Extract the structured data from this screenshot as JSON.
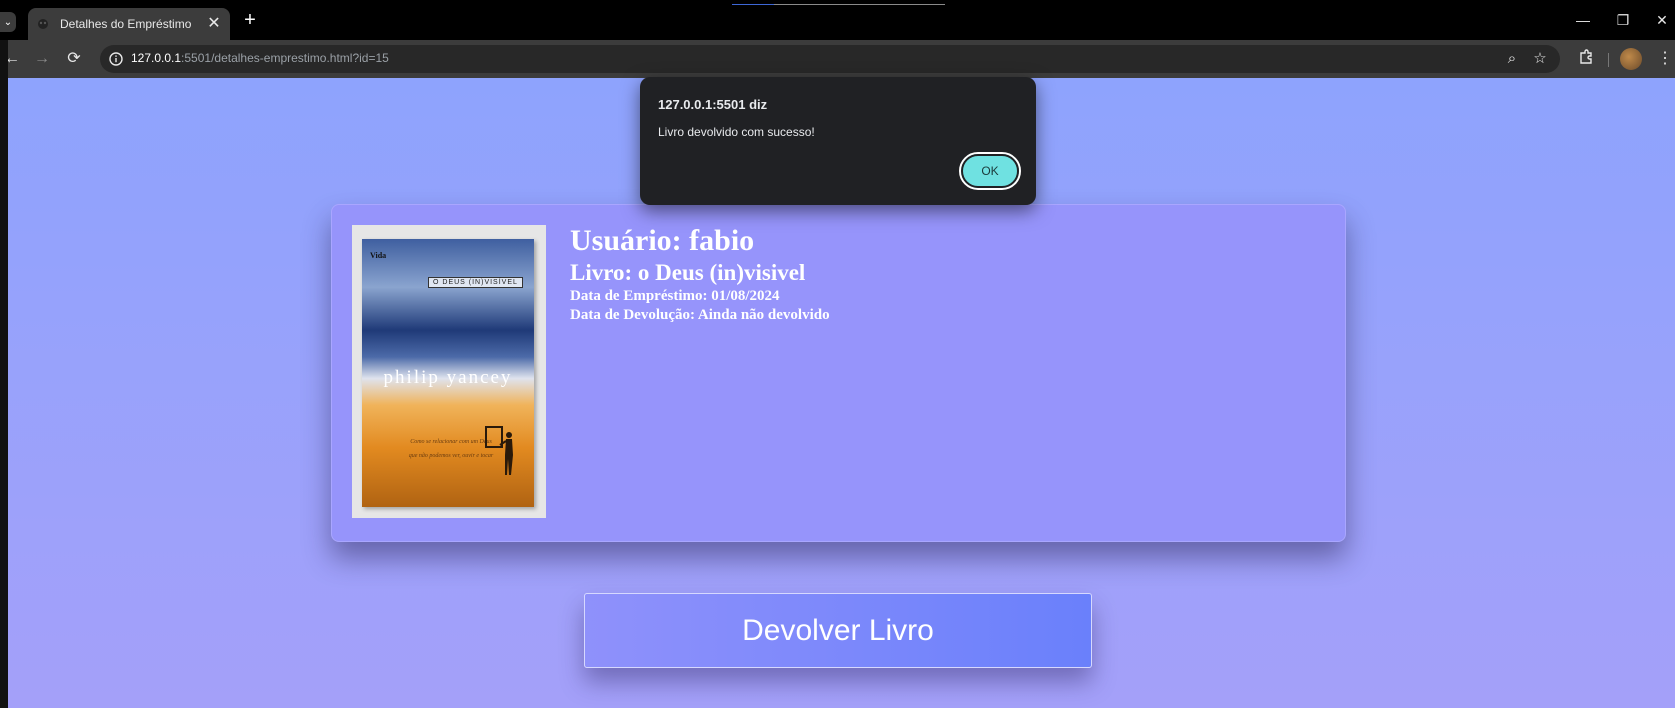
{
  "browser": {
    "tab": {
      "title": "Detalhes do Empréstimo",
      "close": "✕"
    },
    "new_tab": "+",
    "url_host": "127.0.0.1",
    "url_rest": ":5501/detalhes-emprestimo.html?id=15"
  },
  "book": {
    "user_label": "Usuário: fabio",
    "book_label": "Livro: o Deus (in)visivel",
    "loan_date_label": "Data de Empréstimo: 01/08/2024",
    "return_date_label": "Data de Devolução: Ainda não devolvido",
    "cover": {
      "publisher": "Vida",
      "title": "O DEUS (IN)VISÍVEL",
      "author": "philip yancey",
      "tagline_1": "Como se relacionar com um Deus",
      "tagline_2": "que não podemos ver, ouvir e tocar"
    }
  },
  "actions": {
    "return_button": "Devolver Livro"
  },
  "alert": {
    "title": "127.0.0.1:5501 diz",
    "message": "Livro devolvido com sucesso!",
    "ok": "OK"
  },
  "colors": {
    "page_gradient_top": "#8ea3fd",
    "page_gradient_bottom": "#a4a0f9",
    "card": "#9694fb",
    "ok_button": "#6fe1e1"
  }
}
